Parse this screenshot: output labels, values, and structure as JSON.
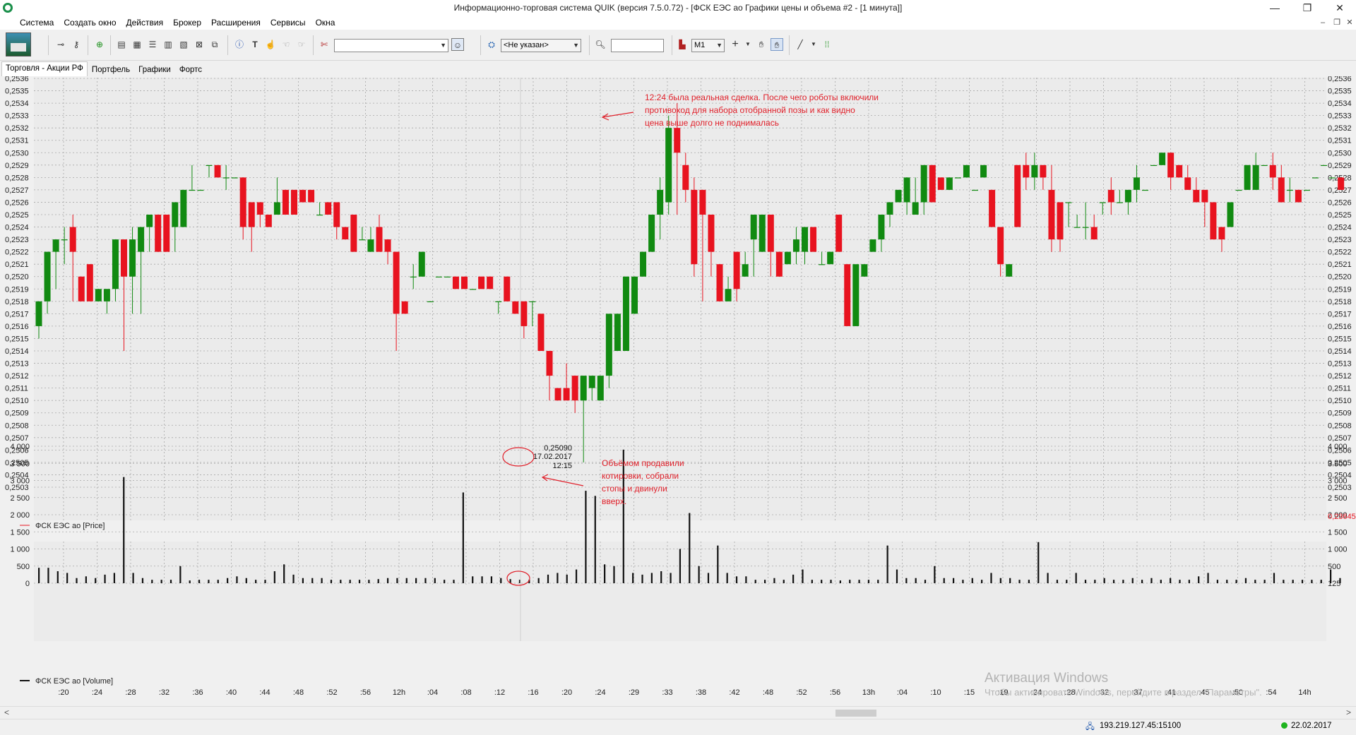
{
  "window": {
    "title": "Информационно-торговая система QUIK (версия 7.5.0.72) - [ФСК ЕЭС ао Графики цены и объема #2 - [1 минута]]",
    "controls": {
      "minimize": "—",
      "restore": "❐",
      "close": "✕"
    }
  },
  "menu": [
    "Система",
    "Создать окно",
    "Действия",
    "Брокер",
    "Расширения",
    "Сервисы",
    "Окна"
  ],
  "toolbar": {
    "account_select": "",
    "client_select": "<Не указан>",
    "search_value": "",
    "interval_select": "M1"
  },
  "tabs": [
    "Торговля - Акции РФ",
    "Портфель",
    "Графики",
    "Фортс"
  ],
  "chart": {
    "price_axis_labels": [
      "0,2536",
      "0,2535",
      "0,2534",
      "0,2533",
      "0,2532",
      "0,2531",
      "0,2530",
      "0,2529",
      "0,2528",
      "0,2527",
      "0,2526",
      "0,2525",
      "0,2524",
      "0,2523",
      "0,2522",
      "0,2521",
      "0,2520",
      "0,2519",
      "0,2518",
      "0,2517",
      "0,2516",
      "0,2515",
      "0,2514",
      "0,2513",
      "0,2512",
      "0,2511",
      "0,2510",
      "0,2509",
      "0,2508",
      "0,2507",
      "0,2506",
      "0,2505",
      "0,2504",
      "0,2503"
    ],
    "price_extra_label": "0,23645",
    "price_legend": "ФСК ЕЭС ао [Price]",
    "volume_axis_labels_left": [
      "4 000",
      "3 500",
      "3 000",
      "2 500",
      "2 000",
      "1 500",
      "1 000",
      "500",
      "0"
    ],
    "volume_axis_labels_right": [
      "4 000",
      "3 500",
      "3 000",
      "2 500",
      "2 000",
      "1 500",
      "1 000",
      "500",
      "125"
    ],
    "volume_legend": "ФСК ЕЭС ао [Volume]",
    "time_labels": [
      ":20",
      ":24",
      ":28",
      ":32",
      ":36",
      ":40",
      ":44",
      ":48",
      ":52",
      ":56",
      "12h",
      ":04",
      ":08",
      ":12",
      ":16",
      ":20",
      ":24",
      ":29",
      ":33",
      ":38",
      ":42",
      ":48",
      ":52",
      ":56",
      "13h",
      ":04",
      ":10",
      ":15",
      ":19",
      ":24",
      ":28",
      ":32",
      ":37",
      ":41",
      ":45",
      ":50",
      ":54",
      "14h"
    ],
    "crosshair": {
      "price": "0,25090",
      "date": "17.02.2017",
      "time": "12:15"
    },
    "annotation_top": [
      "12:24 была реальная сделка. После чего роботы включили",
      "противоход для набора отобранной позы и как видно",
      "цена выше долго не поднималась"
    ],
    "annotation_bottom": [
      "Объёмом продавили",
      "котировки, собрали",
      "стопы и двинули",
      "вверх."
    ],
    "colors": {
      "up": "#118a11",
      "down": "#e8131f",
      "annotation": "#e0202a",
      "grid": "#9a9a9a",
      "background": "#ebebeb"
    }
  },
  "chart_data": [
    {
      "type": "candlestick",
      "series": [
        {
          "name": "ФСК ЕЭС ао [Price]"
        }
      ],
      "ylim": [
        0.2503,
        0.2536
      ],
      "candles": [
        [
          0.2516,
          0.2518,
          0.2515,
          0.2518
        ],
        [
          0.2518,
          0.2522,
          0.2517,
          0.2522
        ],
        [
          0.2522,
          0.2523,
          0.2519,
          0.2523
        ],
        [
          0.2523,
          0.2524,
          0.2521,
          0.2523
        ],
        [
          0.2524,
          0.2525,
          0.2518,
          0.2522
        ],
        [
          0.252,
          0.252,
          0.2518,
          0.2518
        ],
        [
          0.2521,
          0.2521,
          0.2518,
          0.2518
        ],
        [
          0.2518,
          0.2519,
          0.2518,
          0.2519
        ],
        [
          0.2518,
          0.2519,
          0.2517,
          0.2519
        ],
        [
          0.2519,
          0.2523,
          0.2518,
          0.2523
        ],
        [
          0.2523,
          0.2523,
          0.2514,
          0.252
        ],
        [
          0.252,
          0.2524,
          0.2517,
          0.2523
        ],
        [
          0.2522,
          0.2524,
          0.2517,
          0.2524
        ],
        [
          0.2524,
          0.2525,
          0.2522,
          0.2525
        ],
        [
          0.2525,
          0.2525,
          0.2522,
          0.2522
        ],
        [
          0.2525,
          0.2525,
          0.2522,
          0.2522
        ],
        [
          0.2524,
          0.2526,
          0.2522,
          0.2526
        ],
        [
          0.2524,
          0.2527,
          0.2524,
          0.2527
        ],
        [
          0.2527,
          0.2529,
          0.2527,
          0.2527
        ],
        [
          0.2527,
          0.2527,
          0.2527,
          0.2527
        ],
        [
          0.2529,
          0.2529,
          0.2528,
          0.2529
        ],
        [
          0.2529,
          0.2529,
          0.2528,
          0.2528
        ],
        [
          0.2528,
          0.2529,
          0.2527,
          0.2528
        ],
        [
          0.2528,
          0.2528,
          0.2528,
          0.2528
        ],
        [
          0.2528,
          0.2528,
          0.2523,
          0.2524
        ],
        [
          0.2526,
          0.2526,
          0.2522,
          0.2524
        ],
        [
          0.2526,
          0.2526,
          0.2524,
          0.2525
        ],
        [
          0.2525,
          0.2525,
          0.2524,
          0.2524
        ],
        [
          0.2525,
          0.2528,
          0.2525,
          0.2526
        ],
        [
          0.2527,
          0.2527,
          0.2525,
          0.2525
        ],
        [
          0.2527,
          0.2527,
          0.2525,
          0.2525
        ],
        [
          0.2527,
          0.2527,
          0.2526,
          0.2526
        ],
        [
          0.2527,
          0.2527,
          0.2526,
          0.2526
        ],
        [
          0.2525,
          0.2526,
          0.2525,
          0.2525
        ],
        [
          0.2526,
          0.2526,
          0.2525,
          0.2525
        ],
        [
          0.2526,
          0.2526,
          0.2523,
          0.2524
        ],
        [
          0.2524,
          0.2524,
          0.2523,
          0.2523
        ],
        [
          0.2525,
          0.2525,
          0.2522,
          0.2522
        ],
        [
          0.2523,
          0.2524,
          0.2523,
          0.2523
        ],
        [
          0.2522,
          0.2524,
          0.2522,
          0.2523
        ],
        [
          0.2524,
          0.2525,
          0.2522,
          0.2522
        ],
        [
          0.2523,
          0.2523,
          0.2521,
          0.2522
        ],
        [
          0.2522,
          0.2522,
          0.2514,
          0.2517
        ],
        [
          0.2518,
          0.2518,
          0.2517,
          0.2517
        ],
        [
          0.252,
          0.2521,
          0.2519,
          0.252
        ],
        [
          0.252,
          0.2522,
          0.252,
          0.2522
        ],
        [
          0.2518,
          0.2518,
          0.2518,
          0.2518
        ],
        [
          0.252,
          0.252,
          0.252,
          0.252
        ],
        [
          0.252,
          0.252,
          0.252,
          0.252
        ],
        [
          0.252,
          0.252,
          0.2519,
          0.2519
        ],
        [
          0.252,
          0.252,
          0.2519,
          0.2519
        ],
        [
          0.2519,
          0.2519,
          0.2519,
          0.2519
        ],
        [
          0.252,
          0.252,
          0.2519,
          0.2519
        ],
        [
          0.252,
          0.252,
          0.2519,
          0.2519
        ],
        [
          0.2518,
          0.2518,
          0.2517,
          0.2518
        ],
        [
          0.252,
          0.252,
          0.2518,
          0.2518
        ],
        [
          0.2518,
          0.2518,
          0.2517,
          0.2517
        ],
        [
          0.2518,
          0.2518,
          0.2515,
          0.2516
        ],
        [
          0.2518,
          0.2518,
          0.2516,
          0.2518
        ],
        [
          0.2517,
          0.2517,
          0.2514,
          0.2514
        ],
        [
          0.2514,
          0.2514,
          0.251,
          0.2512
        ],
        [
          0.2511,
          0.2511,
          0.251,
          0.251
        ],
        [
          0.2511,
          0.2513,
          0.251,
          0.251
        ],
        [
          0.2512,
          0.2512,
          0.2509,
          0.251
        ],
        [
          0.251,
          0.2512,
          0.2505,
          0.2512
        ],
        [
          0.2511,
          0.2512,
          0.251,
          0.2512
        ],
        [
          0.251,
          0.2512,
          0.251,
          0.2512
        ],
        [
          0.2512,
          0.2513,
          0.2511,
          0.2517
        ],
        [
          0.2514,
          0.2517,
          0.2514,
          0.2517
        ],
        [
          0.2514,
          0.252,
          0.2514,
          0.252
        ],
        [
          0.2517,
          0.252,
          0.2517,
          0.252
        ],
        [
          0.252,
          0.2522,
          0.252,
          0.2522
        ],
        [
          0.2522,
          0.2525,
          0.2522,
          0.2525
        ],
        [
          0.2525,
          0.2528,
          0.2523,
          0.2527
        ],
        [
          0.2526,
          0.2533,
          0.2525,
          0.2532
        ],
        [
          0.2532,
          0.2534,
          0.2525,
          0.253
        ],
        [
          0.2529,
          0.253,
          0.2526,
          0.2527
        ],
        [
          0.2527,
          0.2528,
          0.252,
          0.2521
        ],
        [
          0.2527,
          0.2527,
          0.2518,
          0.2525
        ],
        [
          0.2525,
          0.2525,
          0.252,
          0.2522
        ],
        [
          0.2521,
          0.2521,
          0.2518,
          0.2518
        ],
        [
          0.2518,
          0.252,
          0.2518,
          0.2519
        ],
        [
          0.2522,
          0.2522,
          0.2518,
          0.2519
        ],
        [
          0.252,
          0.2522,
          0.252,
          0.2521
        ],
        [
          0.2523,
          0.2524,
          0.252,
          0.2525
        ],
        [
          0.2522,
          0.2525,
          0.2522,
          0.2525
        ],
        [
          0.2525,
          0.2525,
          0.252,
          0.2522
        ],
        [
          0.2522,
          0.2522,
          0.252,
          0.252
        ],
        [
          0.2521,
          0.2522,
          0.2521,
          0.2522
        ],
        [
          0.2522,
          0.2524,
          0.2521,
          0.2523
        ],
        [
          0.2522,
          0.2524,
          0.2521,
          0.2524
        ],
        [
          0.2524,
          0.2524,
          0.2522,
          0.2522
        ],
        [
          0.2521,
          0.2522,
          0.2521,
          0.2521
        ],
        [
          0.2521,
          0.2522,
          0.2521,
          0.2522
        ],
        [
          0.2525,
          0.2525,
          0.2522,
          0.2522
        ],
        [
          0.2521,
          0.2521,
          0.2516,
          0.2516
        ],
        [
          0.2516,
          0.252,
          0.2516,
          0.2521
        ],
        [
          0.252,
          0.2521,
          0.252,
          0.2521
        ],
        [
          0.2522,
          0.2523,
          0.2522,
          0.2523
        ],
        [
          0.2523,
          0.2525,
          0.2522,
          0.2525
        ],
        [
          0.2525,
          0.2526,
          0.2524,
          0.2526
        ],
        [
          0.2526,
          0.2527,
          0.2526,
          0.2527
        ],
        [
          0.2526,
          0.2528,
          0.2525,
          0.2528
        ],
        [
          0.2525,
          0.2528,
          0.2525,
          0.2526
        ],
        [
          0.2526,
          0.2529,
          0.2525,
          0.2529
        ],
        [
          0.2529,
          0.2529,
          0.2526,
          0.2526
        ],
        [
          0.2528,
          0.2528,
          0.2527,
          0.2527
        ],
        [
          0.2527,
          0.2528,
          0.2527,
          0.2528
        ],
        [
          0.2528,
          0.2528,
          0.2528,
          0.2528
        ],
        [
          0.2528,
          0.2529,
          0.2528,
          0.2529
        ],
        [
          0.2527,
          0.2527,
          0.2527,
          0.2527
        ],
        [
          0.2528,
          0.2529,
          0.2528,
          0.2529
        ],
        [
          0.2527,
          0.2527,
          0.2524,
          0.2524
        ],
        [
          0.2524,
          0.2524,
          0.252,
          0.2521
        ],
        [
          0.252,
          0.2521,
          0.252,
          0.2521
        ],
        [
          0.2529,
          0.2529,
          0.2524,
          0.2524
        ],
        [
          0.2529,
          0.253,
          0.2527,
          0.2528
        ],
        [
          0.2528,
          0.253,
          0.2527,
          0.2529
        ],
        [
          0.2529,
          0.2529,
          0.2527,
          0.2528
        ],
        [
          0.2527,
          0.2529,
          0.2522,
          0.2523
        ],
        [
          0.2526,
          0.2526,
          0.2522,
          0.2523
        ],
        [
          0.2526,
          0.2526,
          0.2524,
          0.2526
        ],
        [
          0.2524,
          0.2525,
          0.2524,
          0.2524
        ],
        [
          0.2524,
          0.2526,
          0.2523,
          0.2524
        ],
        [
          0.2524,
          0.2525,
          0.2523,
          0.2523
        ],
        [
          0.2526,
          0.2526,
          0.2525,
          0.2526
        ],
        [
          0.2527,
          0.2528,
          0.2525,
          0.2526
        ],
        [
          0.2526,
          0.2527,
          0.2526,
          0.2526
        ],
        [
          0.2526,
          0.2527,
          0.2525,
          0.2527
        ],
        [
          0.2527,
          0.2529,
          0.2526,
          0.2528
        ],
        [
          0.2527,
          0.2527,
          0.2527,
          0.2527
        ],
        [
          0.2529,
          0.2529,
          0.2529,
          0.2529
        ],
        [
          0.2529,
          0.253,
          0.2529,
          0.253
        ],
        [
          0.253,
          0.253,
          0.2527,
          0.2528
        ],
        [
          0.2529,
          0.2529,
          0.2528,
          0.2528
        ],
        [
          0.2528,
          0.2529,
          0.2527,
          0.2527
        ],
        [
          0.2527,
          0.2528,
          0.2526,
          0.2526
        ],
        [
          0.2527,
          0.2527,
          0.2524,
          0.2526
        ],
        [
          0.2526,
          0.2526,
          0.2523,
          0.2523
        ],
        [
          0.2524,
          0.2524,
          0.2522,
          0.2523
        ],
        [
          0.2524,
          0.2526,
          0.2524,
          0.2526
        ],
        [
          0.2527,
          0.2527,
          0.2527,
          0.2527
        ],
        [
          0.2527,
          0.2529,
          0.2527,
          0.2529
        ],
        [
          0.2527,
          0.253,
          0.2527,
          0.2529
        ],
        [
          0.2529,
          0.2529,
          0.2529,
          0.2529
        ],
        [
          0.2529,
          0.253,
          0.2527,
          0.2528
        ],
        [
          0.2528,
          0.2529,
          0.2526,
          0.2526
        ],
        [
          0.2527,
          0.2528,
          0.2526,
          0.2527
        ],
        [
          0.2527,
          0.2527,
          0.2526,
          0.2526
        ],
        [
          0.2527,
          0.2527,
          0.2527,
          0.2527
        ],
        [
          0.2528,
          0.2528,
          0.2528,
          0.2528
        ],
        [
          0.2529,
          0.2529,
          0.2529,
          0.2529
        ],
        [
          0.2528,
          0.2528,
          0.2528,
          0.2528
        ],
        [
          0.2528,
          0.2528,
          0.2527,
          0.2527
        ]
      ]
    },
    {
      "type": "bar",
      "series": [
        {
          "name": "ФСК ЕЭС ао [Volume]"
        }
      ],
      "ylim": [
        0,
        4000
      ],
      "values": [
        450,
        450,
        350,
        300,
        150,
        200,
        150,
        250,
        300,
        3100,
        300,
        150,
        100,
        100,
        100,
        500,
        80,
        100,
        100,
        100,
        150,
        200,
        150,
        100,
        100,
        350,
        550,
        250,
        150,
        150,
        150,
        100,
        100,
        100,
        100,
        100,
        120,
        150,
        150,
        150,
        150,
        150,
        150,
        100,
        100,
        2650,
        200,
        200,
        200,
        150,
        120,
        100,
        100,
        150,
        250,
        300,
        250,
        400,
        2700,
        2550,
        550,
        500,
        3900,
        300,
        250,
        300,
        350,
        300,
        1000,
        2050,
        500,
        300,
        1100,
        300,
        200,
        200,
        100,
        100,
        150,
        100,
        250,
        400,
        100,
        100,
        100,
        80,
        100,
        100,
        100,
        100,
        1100,
        400,
        150,
        150,
        100,
        500,
        150,
        150,
        100,
        150,
        100,
        300,
        150,
        150,
        100,
        100,
        1200,
        300,
        100,
        100,
        300,
        100,
        100,
        150,
        100,
        100,
        150,
        100,
        150,
        100,
        150,
        100,
        100,
        200,
        300,
        100,
        100,
        100,
        150,
        100,
        100,
        300,
        100,
        100,
        100,
        100,
        100,
        400,
        150
      ]
    }
  ],
  "scrollbar": {
    "left": "<",
    "right": ">"
  },
  "status": {
    "connection": "193.219.127.45:15100",
    "date": "22.02.2017"
  },
  "watermark": {
    "title": "Активация Windows",
    "text": "Чтобы активировать Windows, перейдите в раздел \"Параметры\"."
  }
}
